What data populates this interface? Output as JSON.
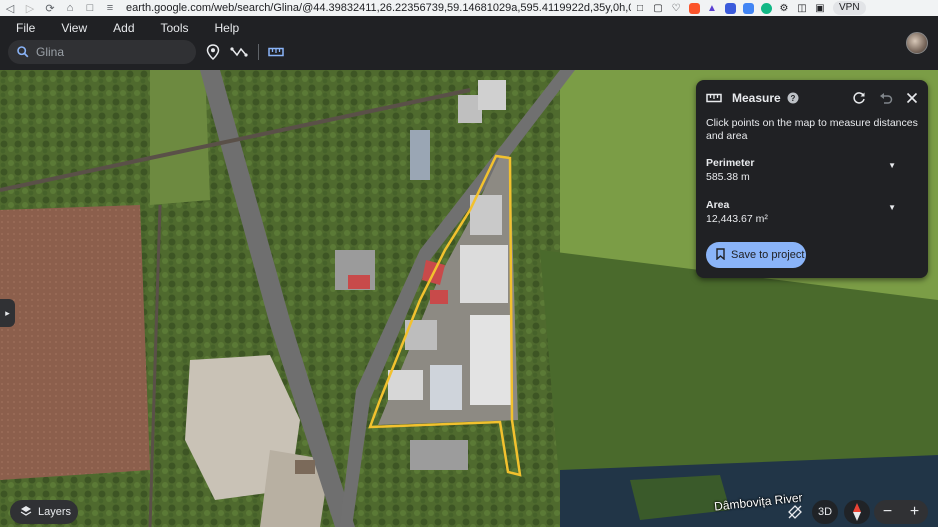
{
  "browser": {
    "url": "earth.google.com/web/search/Glina/@44.39832411,26.22356739,59.14681029a,595.4119922d,35y,0h,0t,0r/data=...",
    "vpn_label": "VPN"
  },
  "menu": {
    "items": [
      "File",
      "View",
      "Add",
      "Tools",
      "Help"
    ]
  },
  "toolbar": {
    "search_placeholder": "Glina"
  },
  "map": {
    "river_label": "Dâmbovița River",
    "layers_label": "Layers",
    "view_3d_label": "3D"
  },
  "measure": {
    "title": "Measure",
    "instructions": "Click points on the map to measure distances and area",
    "perimeter": {
      "label": "Perimeter",
      "value": "585.38 m"
    },
    "area": {
      "label": "Area",
      "value": "12,443.67 m²"
    },
    "save_label": "Save to project"
  },
  "colors": {
    "polygon_outline": "#f2c12e",
    "save_button": "#8ab4f8",
    "panel_bg": "#202124"
  }
}
